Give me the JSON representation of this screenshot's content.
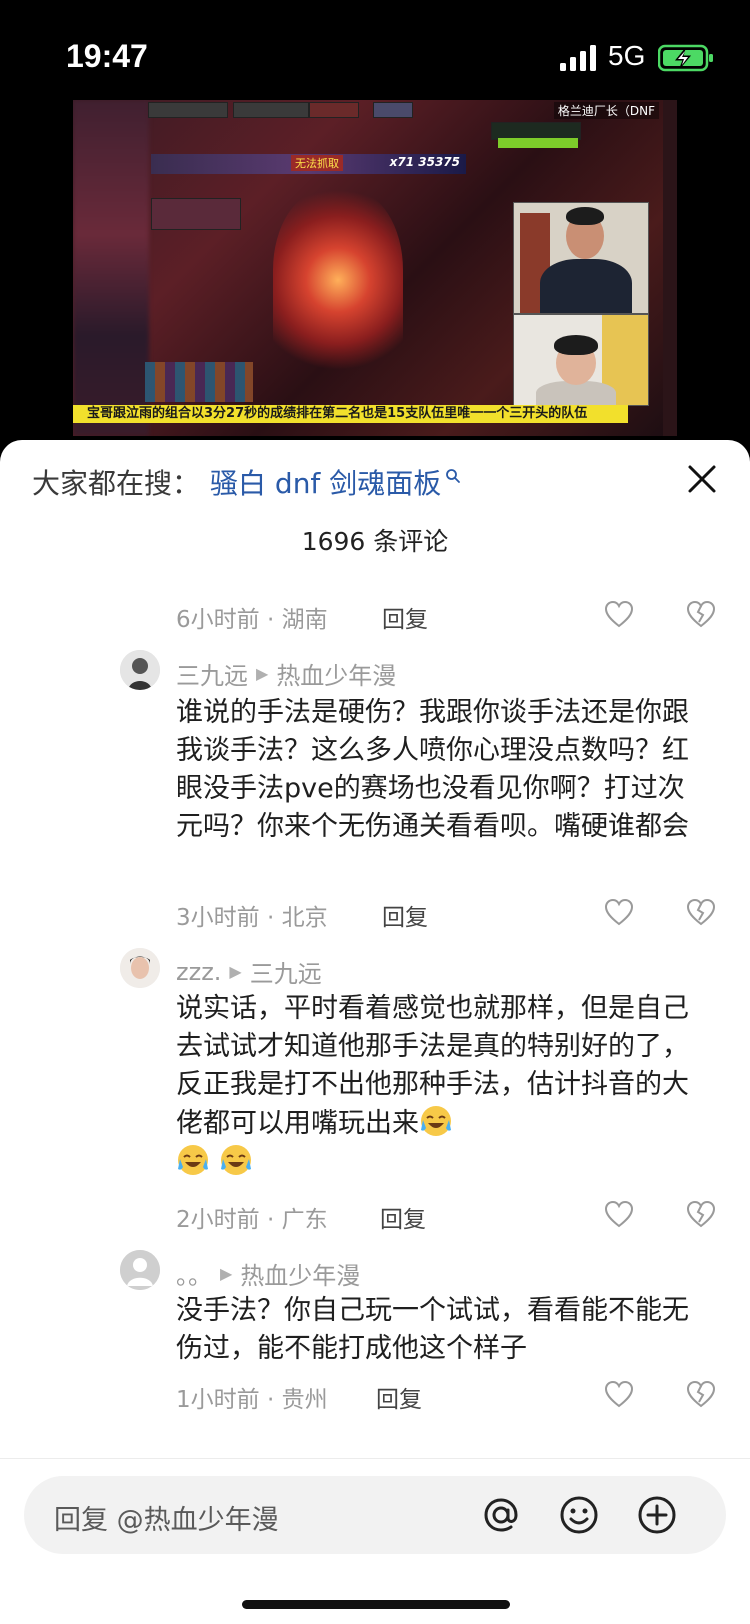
{
  "status_bar": {
    "time": "19:47",
    "network": "5G"
  },
  "video": {
    "overlay_title": "格兰迪厂长（DNF",
    "score_text": "x71 35375",
    "score_tag": "无法抓取",
    "subtitle": "宝哥跟泣雨的组合以3分27秒的成绩排在第二名也是15支队伍里唯一一个三开头的队伍"
  },
  "sheet": {
    "search_prefix": "大家都在搜：",
    "search_term": "骚白 dnf 剑魂面板",
    "comment_count": "1696 条评论",
    "partial_meta": "6小时前 · 湖南",
    "reply_label": "回复",
    "comments": [
      {
        "author": "三九远",
        "reply_to": "热血少年漫",
        "text": "谁说的手法是硬伤？我跟你谈手法还是你跟我谈手法？这么多人喷你心理没点数吗？红眼没手法pve的赛场也没看见你啊？打过次元吗？你来个无伤通关看看呗。嘴硬谁都会",
        "meta": "3小时前 · 北京"
      },
      {
        "author": "zzz.",
        "reply_to": "三九远",
        "text": "说实话，平时看着感觉也就那样，但是自己去试试才知道他那手法是真的特别好的了，反正我是打不出他那种手法，估计抖音的大佬都可以用嘴玩出来",
        "meta": "2小时前 · 广东"
      },
      {
        "author": "。。",
        "reply_to": "热血少年漫",
        "text": "没手法？你自己玩一个试试，看看能不能无伤过，能不能打成他这个样子",
        "meta": "1小时前 · 贵州"
      }
    ],
    "reply_placeholder": "回复 @热血少年漫"
  },
  "icons": {
    "close": "close-icon",
    "like": "heart-outline-icon",
    "dislike": "broken-heart-icon",
    "mention": "at-icon",
    "emoji": "smiley-icon",
    "add": "plus-circle-icon"
  },
  "colors": {
    "link": "#2a5aa8",
    "meta": "#9a9a9a",
    "subtitle_bg": "#f2e02c",
    "battery_green": "#4cd964"
  }
}
